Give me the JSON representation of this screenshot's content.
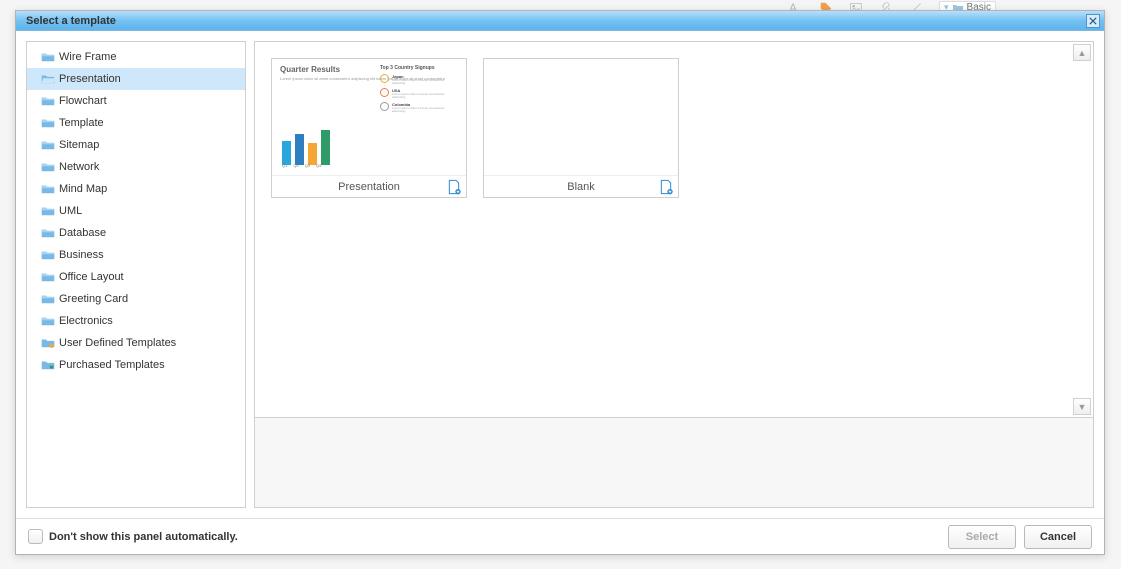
{
  "dialog": {
    "title": "Select a template",
    "categories": [
      {
        "label": "Wire Frame",
        "icon": "folder"
      },
      {
        "label": "Presentation",
        "icon": "folder-open",
        "selected": true
      },
      {
        "label": "Flowchart",
        "icon": "folder"
      },
      {
        "label": "Template",
        "icon": "folder"
      },
      {
        "label": "Sitemap",
        "icon": "folder"
      },
      {
        "label": "Network",
        "icon": "folder"
      },
      {
        "label": "Mind Map",
        "icon": "folder"
      },
      {
        "label": "UML",
        "icon": "folder"
      },
      {
        "label": "Database",
        "icon": "folder"
      },
      {
        "label": "Business",
        "icon": "folder"
      },
      {
        "label": "Office Layout",
        "icon": "folder"
      },
      {
        "label": "Greeting Card",
        "icon": "folder"
      },
      {
        "label": "Electronics",
        "icon": "folder"
      },
      {
        "label": "User Defined Templates",
        "icon": "folder-user"
      },
      {
        "label": "Purchased Templates",
        "icon": "folder-cart"
      }
    ],
    "templates": [
      {
        "label": "Presentation",
        "thumb": "quarter-results"
      },
      {
        "label": "Blank",
        "thumb": "blank"
      }
    ],
    "quarter_thumb": {
      "title": "Quarter Results",
      "subtitle": "Top 3 Country Signups",
      "items": [
        {
          "name": "Japan",
          "color": "#f5a637"
        },
        {
          "name": "USA",
          "color": "#f57a37"
        },
        {
          "name": "Colombia",
          "color": "#9b9b9b"
        }
      ]
    },
    "footer": {
      "checkbox_label": "Don't show this panel automatically.",
      "select_btn": "Select",
      "cancel_btn": "Cancel"
    }
  },
  "chart_data": {
    "type": "bar",
    "categories": [
      "Q1",
      "Q2",
      "Q3",
      "Q4"
    ],
    "values": [
      55,
      70,
      50,
      80
    ],
    "colors": [
      "#2aa7da",
      "#2e7fbf",
      "#f5a637",
      "#2f9b69"
    ],
    "title": "Quarter Results",
    "xlabel": "",
    "ylabel": "",
    "ylim": [
      0,
      100
    ]
  },
  "background": {
    "shapes_label": "Basic"
  }
}
